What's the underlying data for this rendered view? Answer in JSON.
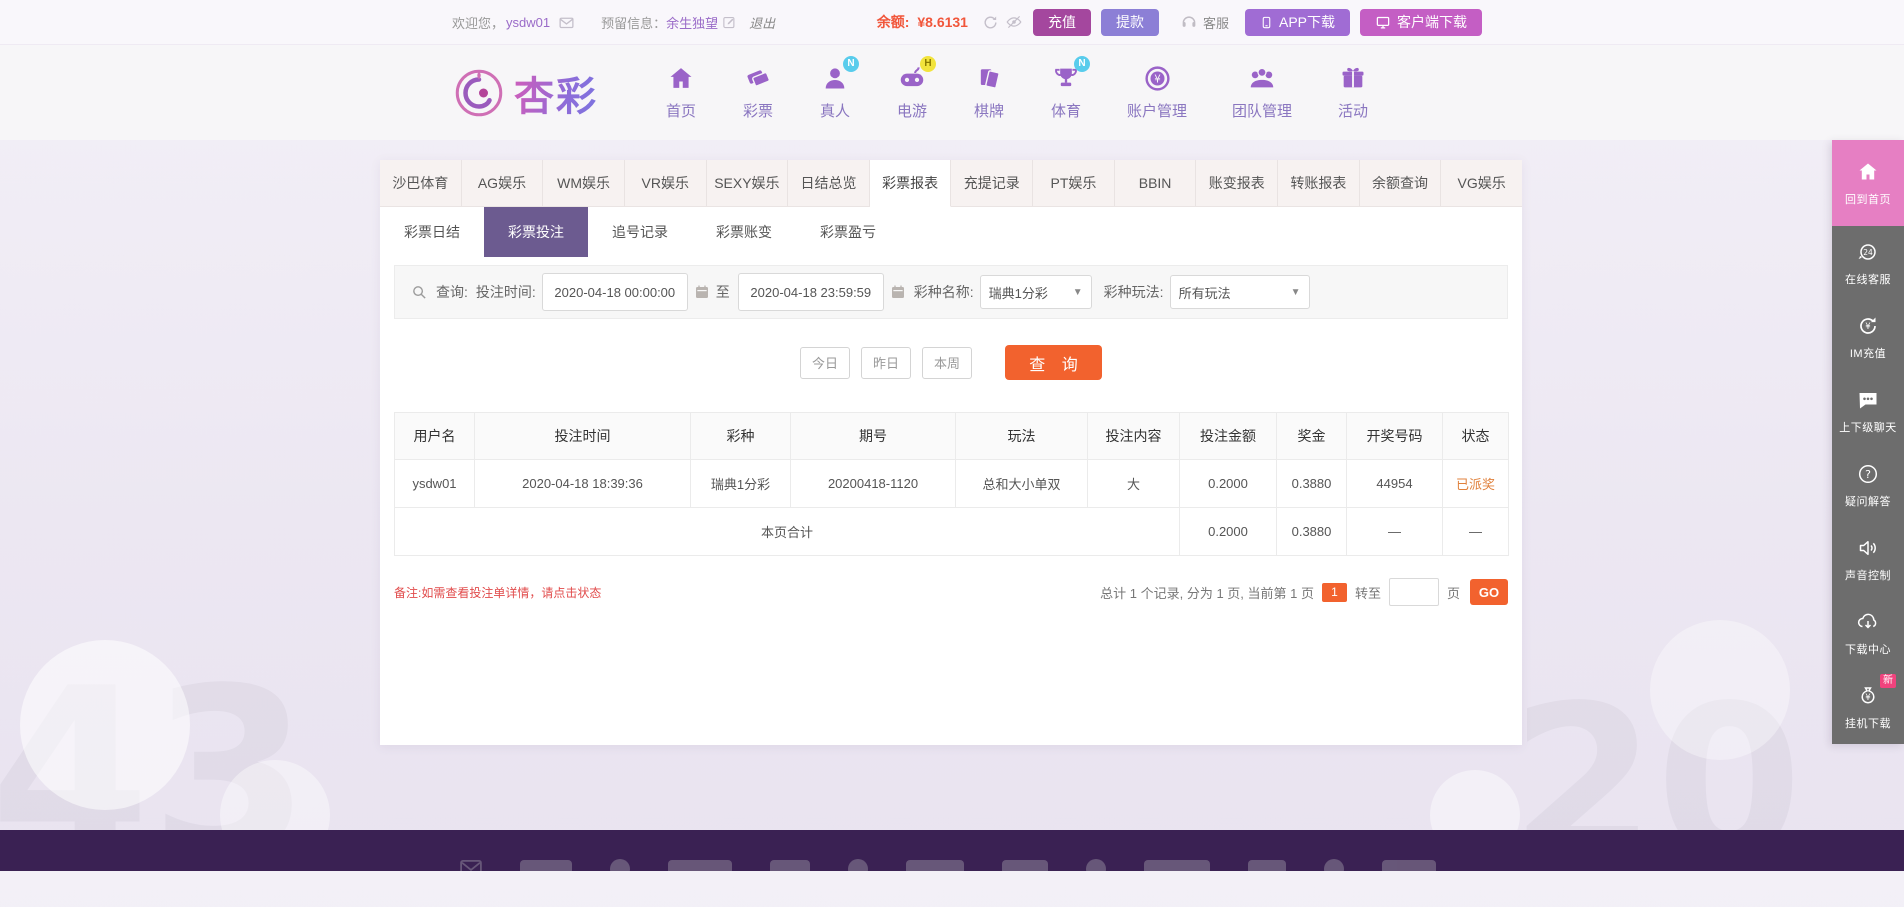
{
  "topbar": {
    "welcome_prefix": "欢迎您，",
    "username": "ysdw01",
    "reserved_label": "预留信息：",
    "reserved_value": "余生独望",
    "logout": "退出",
    "balance_label": "余额:",
    "balance_value": "¥8.6131",
    "recharge": "充值",
    "withdraw": "提款",
    "service": "客服",
    "app_download": "APP下载",
    "client_download": "客户端下载",
    "icons": [
      "envelope-icon",
      "edit-icon",
      "refresh-icon",
      "eye-off-icon",
      "headset-icon",
      "phone-icon",
      "monitor-icon"
    ]
  },
  "header": {
    "brand": "杏彩",
    "nav": [
      {
        "label": "首页",
        "icon": "home-icon",
        "badge": ""
      },
      {
        "label": "彩票",
        "icon": "tickets-icon",
        "badge": ""
      },
      {
        "label": "真人",
        "icon": "person-icon",
        "badge": "N"
      },
      {
        "label": "电游",
        "icon": "gamepad-icon",
        "badge": "H"
      },
      {
        "label": "棋牌",
        "icon": "cards-icon",
        "badge": ""
      },
      {
        "label": "体育",
        "icon": "trophy-icon",
        "badge": "N"
      },
      {
        "label": "账户管理",
        "icon": "account-icon",
        "badge": ""
      },
      {
        "label": "团队管理",
        "icon": "team-icon",
        "badge": ""
      },
      {
        "label": "活动",
        "icon": "gift-icon",
        "badge": ""
      }
    ]
  },
  "tabs": [
    "沙巴体育",
    "AG娱乐",
    "WM娱乐",
    "VR娱乐",
    "SEXY娱乐",
    "日结总览",
    "彩票报表",
    "充提记录",
    "PT娱乐",
    "BBIN",
    "账变报表",
    "转账报表",
    "余额查询",
    "VG娱乐"
  ],
  "active_tab": "彩票报表",
  "subtabs": [
    "彩票日结",
    "彩票投注",
    "追号记录",
    "彩票账变",
    "彩票盈亏"
  ],
  "active_subtab": "彩票投注",
  "query": {
    "query_label": "查询:",
    "time_label": "投注时间:",
    "time_from": "2020-04-18 00:00:00",
    "to_label": "至",
    "time_to": "2020-04-18 23:59:59",
    "lottery_label": "彩种名称:",
    "lottery_value": "瑞典1分彩",
    "play_label": "彩种玩法:",
    "play_value": "所有玩法",
    "btn_today": "今日",
    "btn_yesterday": "昨日",
    "btn_week": "本周",
    "btn_search": "查 询"
  },
  "table": {
    "headers": [
      "用户名",
      "投注时间",
      "彩种",
      "期号",
      "玩法",
      "投注内容",
      "投注金额",
      "奖金",
      "开奖号码",
      "状态"
    ],
    "rows": [
      [
        "ysdw01",
        "2020-04-18 18:39:36",
        "瑞典1分彩",
        "20200418-1120",
        "总和大小单双",
        "大",
        "0.2000",
        "0.3880",
        "44954",
        "已派奖"
      ]
    ],
    "total_label": "本页合计",
    "total_bet_amount": "0.2000",
    "total_prize": "0.3880",
    "total_dash1": "—",
    "total_dash2": "—"
  },
  "footer_note": "备注:如需查看投注单详情，请点击状态",
  "pagination": {
    "summary": "总计 1 个记录, 分为 1 页, 当前第 1 页",
    "current_page": "1",
    "goto_label": "转至",
    "page_unit": "页",
    "go_label": "GO"
  },
  "sidebar": {
    "items": [
      {
        "label": "回到首页",
        "icon": "home-icon"
      },
      {
        "label": "在线客服",
        "icon": "service-24-icon"
      },
      {
        "label": "IM充值",
        "icon": "im-recharge-icon"
      },
      {
        "label": "上下级聊天",
        "icon": "chat-icon"
      },
      {
        "label": "疑问解答",
        "icon": "question-icon"
      },
      {
        "label": "声音控制",
        "icon": "sound-icon"
      },
      {
        "label": "下载中心",
        "icon": "download-icon"
      },
      {
        "label": "挂机下载",
        "icon": "moneybag-icon",
        "badge": "新"
      }
    ]
  },
  "colors": {
    "accent_orange": "#f2622e",
    "balance_orange": "#f1563b",
    "brand_purple": "#9a63c8",
    "active_subtab_purple": "#6c5b90",
    "recharge_magenta": "#a4479e",
    "withdraw_purple": "#8c7fd6",
    "client_pink": "#c45ec4",
    "sidebar_pink": "#e67fc3",
    "sidebar_grey": "#6d6d6d",
    "footer_purple": "#3a2153",
    "status_orange": "#e0813c",
    "note_red": "#e14b4b",
    "badge_n_cyan": "#59ccec",
    "badge_h_yellow": "#f2e33c",
    "new_badge_pink": "#f0437d"
  }
}
